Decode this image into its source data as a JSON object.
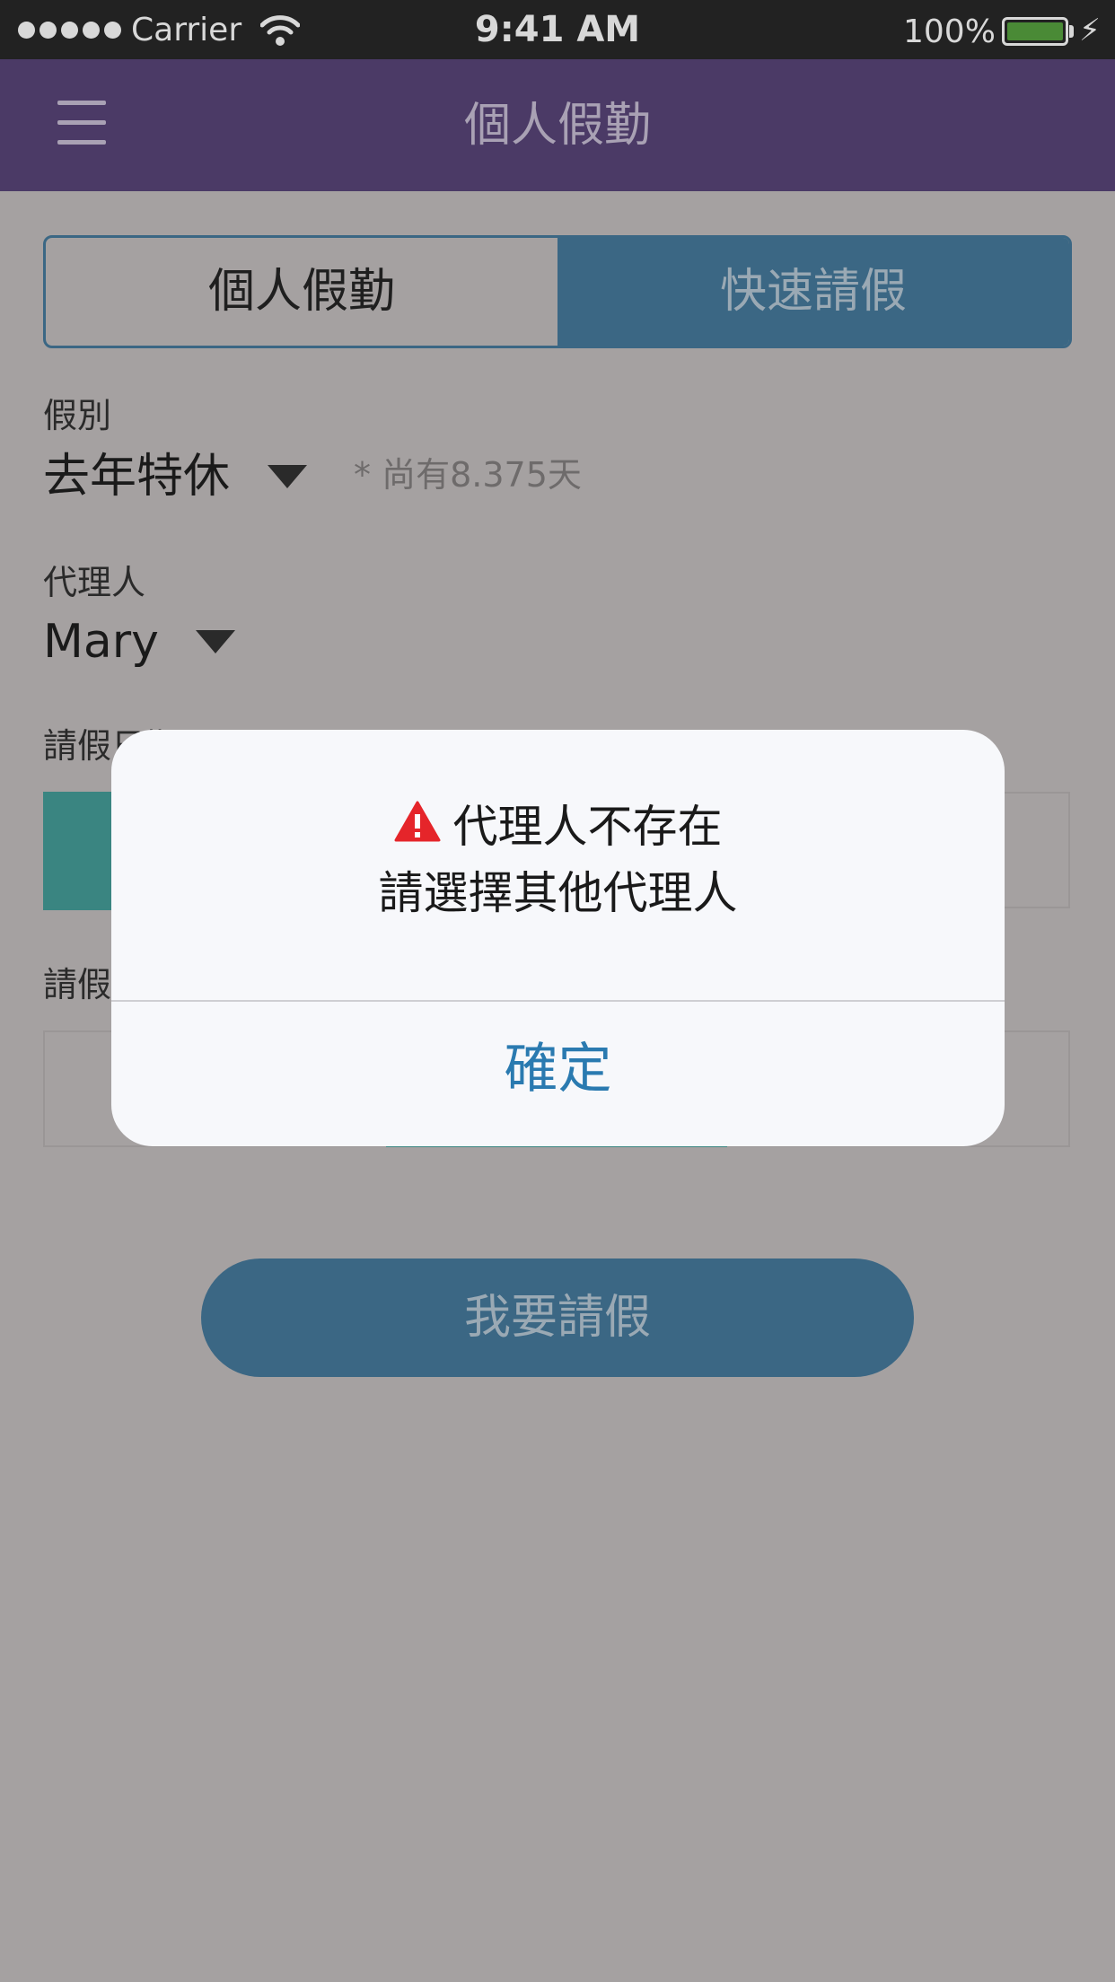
{
  "status_bar": {
    "carrier": "Carrier",
    "signal_dots": 5,
    "time": "9:41 AM",
    "battery_percent": "100%",
    "battery_level": 1.0,
    "battery_color": "#4a8a36"
  },
  "nav": {
    "title": "個人假勤",
    "menu_icon": "hamburger-icon",
    "background": "#4b3a66"
  },
  "tabs": {
    "personal": "個人假勤",
    "quick": "快速請假",
    "selected": "快速請假"
  },
  "form": {
    "leave_type_label": "假別",
    "leave_type_value": "去年特休",
    "leave_balance_hint": "* 尚有8.375天",
    "agent_label": "代理人",
    "agent_value": "Mary",
    "leave_date_label": "請假日期",
    "leave_time_label": "請假"
  },
  "submit_label": "我要請假",
  "dialog": {
    "icon": "warning-icon",
    "line1": "代理人不存在",
    "line2": "請選擇其他代理人",
    "confirm_label": "確定"
  },
  "colors": {
    "accent_blue": "#3b6784",
    "accent_teal": "#3a8581",
    "warning_red": "#e5252a",
    "link_blue": "#2a7ab0"
  }
}
